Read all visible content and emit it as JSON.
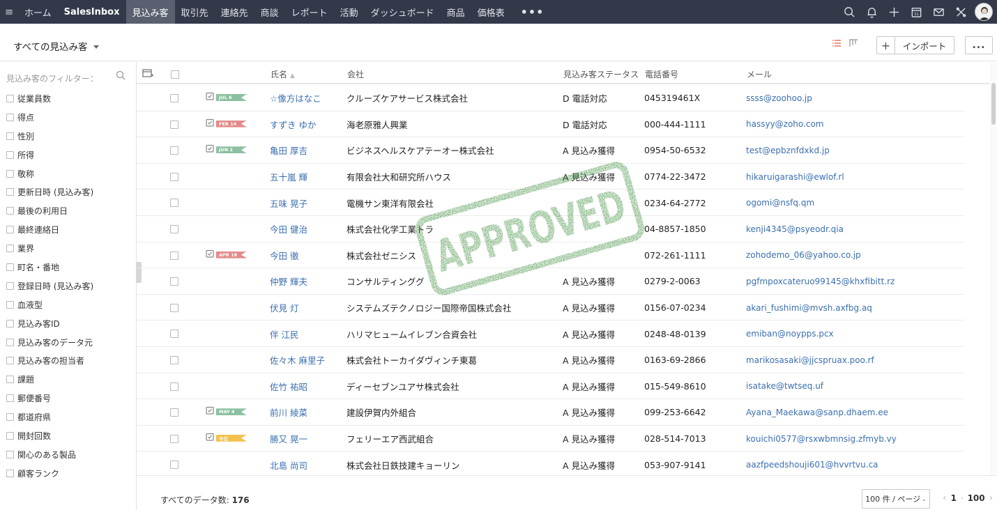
{
  "nav": {
    "items": [
      {
        "label": "ホーム",
        "type": "normal"
      },
      {
        "label": "SalesInbox",
        "type": "brand"
      },
      {
        "label": "見込み客",
        "type": "active"
      },
      {
        "label": "取引先",
        "type": "normal"
      },
      {
        "label": "連絡先",
        "type": "normal"
      },
      {
        "label": "商談",
        "type": "normal"
      },
      {
        "label": "レポート",
        "type": "normal"
      },
      {
        "label": "活動",
        "type": "normal"
      },
      {
        "label": "ダッシュボード",
        "type": "normal"
      },
      {
        "label": "商品",
        "type": "normal"
      },
      {
        "label": "価格表",
        "type": "normal"
      }
    ],
    "more": "•••",
    "right_icons": [
      "search-icon",
      "bell-icon",
      "plus-icon",
      "calendar-icon",
      "mail-icon",
      "tools-icon"
    ],
    "calendar_day": "31"
  },
  "subheader": {
    "view_label": "すべての見込み客",
    "plus": "+",
    "import_label": "インポート",
    "more_label": "..."
  },
  "sidebar": {
    "title": "見込み客のフィルター：",
    "filters": [
      "従業員数",
      "得点",
      "性別",
      "所得",
      "敬称",
      "更新日時 (見込み客)",
      "最後の利用日",
      "最終連絡日",
      "業界",
      "町名・番地",
      "登録日時 (見込み客)",
      "血液型",
      "見込み客ID",
      "見込み客のデータ元",
      "見込み客の担当者",
      "課題",
      "郵便番号",
      "都道府県",
      "開封回数",
      "関心のある製品",
      "顧客ランク"
    ]
  },
  "table": {
    "headers": {
      "name": "氏名",
      "company": "会社",
      "status": "見込み客ステータス",
      "phone": "電話番号",
      "email": "メール"
    },
    "rows": [
      {
        "tag": "JUL 6",
        "tag_color": "green",
        "name": "☆像方はなこ",
        "company": "クルーズケアサービス株式会社",
        "status": "D 電話対応",
        "phone": "045319461X",
        "email": "ssss@zoohoo.jp"
      },
      {
        "tag": "FEB 14",
        "tag_color": "red",
        "name": "すずき ゆか",
        "company": "海老原雅人興業",
        "status": "D 電話対応",
        "phone": "000-444-1111",
        "email": "hassyy@zoho.com"
      },
      {
        "tag": "JUN 2",
        "tag_color": "green",
        "name": "亀田 厚吉",
        "company": "ビジネスヘルスケアテーオー株式会社",
        "status": "A 見込み獲得",
        "phone": "0954-50-6532",
        "email": "test@epbznfdxkd.jp"
      },
      {
        "tag": "",
        "tag_color": "",
        "name": "五十嵐 輝",
        "company": "有限会社大和研究所ハウス",
        "status": "A 見込み獲得",
        "phone": "0774-22-3472",
        "email": "hikaruigarashi@ewlof.rl"
      },
      {
        "tag": "",
        "tag_color": "",
        "name": "五味 晃子",
        "company": "電機サン東洋有限会社",
        "status": "",
        "phone": "0234-64-2772",
        "email": "ogomi@nsfq.qm"
      },
      {
        "tag": "",
        "tag_color": "",
        "name": "今田 健治",
        "company": "株式会社化学工業トラ",
        "status": "",
        "phone": "04-8857-1850",
        "email": "kenji4345@psyeodr.qia"
      },
      {
        "tag": "APR 18",
        "tag_color": "red",
        "name": "今田 徹",
        "company": "株式会社ゼニシス",
        "status": "",
        "phone": "072-261-1111",
        "email": "zohodemo_06@yahoo.co.jp"
      },
      {
        "tag": "",
        "tag_color": "",
        "name": "仲野 輝夫",
        "company": "コンサルティンググ",
        "status": "A 見込み獲得",
        "phone": "0279-2-0063",
        "email": "pgfmpoxcateruo99145@khxfibitt.rz"
      },
      {
        "tag": "",
        "tag_color": "",
        "name": "伏見 灯",
        "company": "システムズテクノロジー国際帝国株式会社",
        "status": "A 見込み獲得",
        "phone": "0156-07-0234",
        "email": "akari_fushimi@mvsh.axfbg.aq"
      },
      {
        "tag": "",
        "tag_color": "",
        "name": "伴 江民",
        "company": "ハリマヒュームイレブン合資会社",
        "status": "A 見込み獲得",
        "phone": "0248-48-0139",
        "email": "emiban@noypps.pcx"
      },
      {
        "tag": "",
        "tag_color": "",
        "name": "佐々木 麻里子",
        "company": "株式会社トーカイダヴィンチ東葛",
        "status": "A 見込み獲得",
        "phone": "0163-69-2866",
        "email": "marikosasaki@jjcspruax.poo.rf"
      },
      {
        "tag": "",
        "tag_color": "",
        "name": "佐竹 祐昭",
        "company": "ディーセブンユアサ株式会社",
        "status": "A 見込み獲得",
        "phone": "015-549-8610",
        "email": "isatake@twtseq.uf"
      },
      {
        "tag": "MAY 4",
        "tag_color": "green",
        "name": "前川 綾菜",
        "company": "建設伊賀内外組合",
        "status": "A 見込み獲得",
        "phone": "099-253-6642",
        "email": "Ayana_Maekawa@sanp.dhaem.ee"
      },
      {
        "tag": "今日",
        "tag_color": "yellow",
        "name": "勝又 晃一",
        "company": "フェリーエア西武組合",
        "status": "A 見込み獲得",
        "phone": "028-514-7013",
        "email": "kouichi0577@rsxwbmnsig.zfmyb.vy"
      },
      {
        "tag": "",
        "tag_color": "",
        "name": "北島 尚司",
        "company": "株式会社日鉄技建キョーリン",
        "status": "A 見込み獲得",
        "phone": "053-907-9141",
        "email": "aazfpeedshouji601@hvvrtvu.ca"
      }
    ]
  },
  "footer": {
    "total_label": "すべてのデータ数:",
    "total_count": "176",
    "per_page": "100 件 / ページ",
    "page_from": "1",
    "page_to": "100"
  },
  "stamp": {
    "text": "APPROVED",
    "color": "#3f8f3f"
  }
}
